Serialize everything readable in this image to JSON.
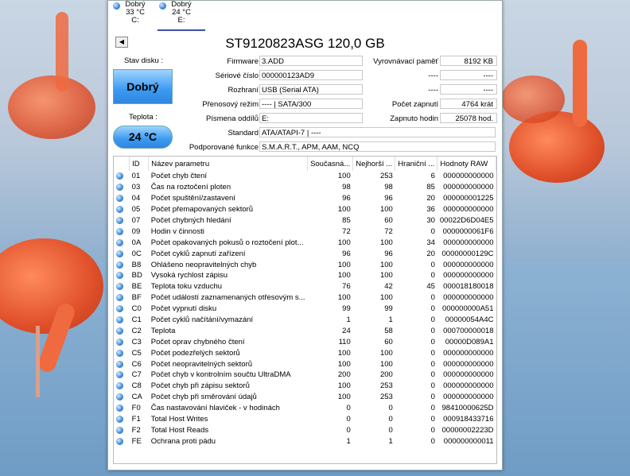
{
  "disks": [
    {
      "status": "Dobrý",
      "temp": "33 °C",
      "letter": "C:"
    },
    {
      "status": "Dobrý",
      "temp": "24 °C",
      "letter": "E:"
    }
  ],
  "header": {
    "model": "ST9120823ASG 120,0 GB",
    "prev_icon": "left-arrow-icon"
  },
  "status": {
    "label": "Stav disku :",
    "value": "Dobrý"
  },
  "temperature": {
    "label": "Teplota :",
    "value": "24 °C"
  },
  "info": {
    "firmware": {
      "label": "Firmware",
      "value": "3.ADD"
    },
    "serial": {
      "label": "Sériové číslo",
      "value": "000000123AD9"
    },
    "interface": {
      "label": "Rozhraní",
      "value": "USB (Serial ATA)"
    },
    "transfer": {
      "label": "Přenosový režim",
      "value": "---- | SATA/300"
    },
    "letters": {
      "label": "Písmena oddílů",
      "value": "E:"
    },
    "standard": {
      "label": "Standard",
      "value": "ATA/ATAPI-7 | ----"
    },
    "features": {
      "label": "Podporované funkce",
      "value": "S.M.A.R.T., APM, AAM, NCQ"
    },
    "buffer": {
      "label": "Vyrovnávací paměť",
      "value": "8192 KB"
    },
    "blank1": {
      "label": "----",
      "value": "----"
    },
    "blank2": {
      "label": "----",
      "value": "----"
    },
    "power_on_count": {
      "label": "Počet zapnutí",
      "value": "4764 krát"
    },
    "power_on_hours": {
      "label": "Zapnuto hodin",
      "value": "25078 hod."
    }
  },
  "table": {
    "headers": [
      "ID",
      "Název parametru",
      "Současná...",
      "Nejhorší ...",
      "Hraniční ...",
      "Hodnoty RAW"
    ],
    "rows": [
      [
        "01",
        "Počet chyb čtení",
        "100",
        "253",
        "6",
        "000000000000"
      ],
      [
        "03",
        "Čas na roztočení ploten",
        "98",
        "98",
        "85",
        "000000000000"
      ],
      [
        "04",
        "Počet spuštění/zastavení",
        "96",
        "96",
        "20",
        "000000001225"
      ],
      [
        "05",
        "Počet přemapovaných sektorů",
        "100",
        "100",
        "36",
        "000000000000"
      ],
      [
        "07",
        "Počet chybných hledání",
        "85",
        "60",
        "30",
        "00022D6D04E5"
      ],
      [
        "09",
        "Hodin v činnosti",
        "72",
        "72",
        "0",
        "0000000061F6"
      ],
      [
        "0A",
        "Počet opakovaných pokusů o roztočení plot...",
        "100",
        "100",
        "34",
        "000000000000"
      ],
      [
        "0C",
        "Počet cyklů zapnutí zařízení",
        "96",
        "96",
        "20",
        "00000000129C"
      ],
      [
        "B8",
        "Ohlášeno neopravitelných chyb",
        "100",
        "100",
        "0",
        "000000000000"
      ],
      [
        "BD",
        "Vysoká rychlost zápisu",
        "100",
        "100",
        "0",
        "000000000000"
      ],
      [
        "BE",
        "Teplota toku vzduchu",
        "76",
        "42",
        "45",
        "000018180018"
      ],
      [
        "BF",
        "Počet událostí zaznamenaných otřesovým s...",
        "100",
        "100",
        "0",
        "000000000000"
      ],
      [
        "C0",
        "Počet vypnutí disku",
        "99",
        "99",
        "0",
        "000000000A51"
      ],
      [
        "C1",
        "Počet cyklů načítání/vymazání",
        "1",
        "1",
        "0",
        "00000054A4C"
      ],
      [
        "C2",
        "Teplota",
        "24",
        "58",
        "0",
        "000700000018"
      ],
      [
        "C3",
        "Počet oprav chybného čtení",
        "110",
        "60",
        "0",
        "00000D089A1"
      ],
      [
        "C5",
        "Počet podezřelých sektorů",
        "100",
        "100",
        "0",
        "000000000000"
      ],
      [
        "C6",
        "Počet neopravitelných sektorů",
        "100",
        "100",
        "0",
        "000000000000"
      ],
      [
        "C7",
        "Počet chyb v kontrolním součtu UltraDMA",
        "200",
        "200",
        "0",
        "000000000000"
      ],
      [
        "C8",
        "Počet chyb při zápisu sektorů",
        "100",
        "253",
        "0",
        "000000000000"
      ],
      [
        "CA",
        "Počet chyb při směrování údajů",
        "100",
        "253",
        "0",
        "000000000000"
      ],
      [
        "F0",
        "Čas nastavování hlaviček - v hodinách",
        "0",
        "0",
        "0",
        "98410000625D"
      ],
      [
        "F1",
        "Total Host Writes",
        "0",
        "0",
        "0",
        "000918433716"
      ],
      [
        "F2",
        "Total Host Reads",
        "0",
        "0",
        "0",
        "00000002223D"
      ],
      [
        "FE",
        "Ochrana proti pádu",
        "1",
        "1",
        "0",
        "000000000011"
      ]
    ]
  }
}
